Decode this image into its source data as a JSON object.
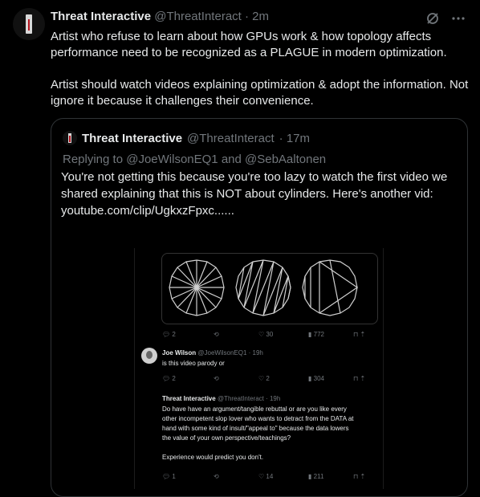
{
  "tweet": {
    "author_name": "Threat Interactive",
    "author_handle": "@ThreatInteract",
    "time": "· 2m",
    "paragraph1": "Artist who refuse to learn about how GPUs work & how topology affects performance need to be recognized as a PLAGUE in modern optimization.",
    "paragraph2": "Artist should watch videos explaining optimization & adopt the information. Not ignore it because it challenges their convenience.",
    "more_icon": "ellipsis-icon",
    "grok_icon": "grok-icon"
  },
  "quote": {
    "author_name": "Threat Interactive",
    "author_handle": "@ThreatInteract",
    "time": "· 17m",
    "replying_to": "Replying to @JoeWilsonEQ1 and @SebAaltonen",
    "text": "You're not getting this because you're too lazy to watch the first video we shared explaining that this is NOT about cylinders. Here's another vid:",
    "link": "youtube.com/clip/UgkxzFpxc......"
  },
  "embedded": {
    "row1": {
      "replies": "2",
      "likes": "30",
      "views": "772"
    },
    "reply1": {
      "name": "Joe Wilson",
      "handle": "@JoeWilsonEQ1 · 19h",
      "text": "is this video parody or",
      "replies": "2",
      "likes": "2",
      "views": "304"
    },
    "reply2": {
      "name": "Threat Interactive",
      "handle": "@ThreatInteract · 19h",
      "line1": "Do have have an argument/tangible rebuttal or are you like every",
      "line2": "other incompetent slop lover who wants to detract from the DATA at",
      "line3": "hand with some kind of insult/\"appeal to\" because the data lowers",
      "line4": "the value of your own perspective/teachings?",
      "line5": "Experience would predict you don't.",
      "replies": "1",
      "likes": "14",
      "views": "211"
    }
  }
}
